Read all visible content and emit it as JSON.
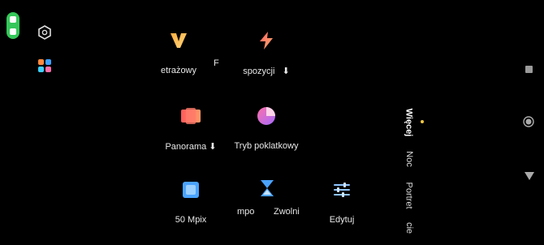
{
  "tiles": [
    {
      "label": "etrażowy",
      "icon": "aperture-v-icon"
    },
    {
      "label": "F",
      "icon": ""
    },
    {
      "label": "spozycji",
      "icon": "lightning-icon",
      "download": true
    },
    {
      "label": "Panorama",
      "icon": "panorama-icon",
      "download": true
    },
    {
      "label": "Tryb poklatkowy",
      "icon": "timelapse-icon"
    },
    {
      "label": "50 Mpix",
      "icon": "grid-50mp-icon"
    },
    {
      "label": "mpo",
      "icon": ""
    },
    {
      "label": "Zwolni",
      "icon": "hourglass-icon"
    },
    {
      "label": "Edytuj",
      "icon": "sliders-icon"
    }
  ],
  "modes": {
    "more": "Więcej",
    "night": "Noc",
    "portrait": "Portret",
    "cut": "cie"
  },
  "download_glyph": "⬇",
  "colors": {
    "status_pill": "#34c759",
    "active_dot": "#f5c842"
  }
}
